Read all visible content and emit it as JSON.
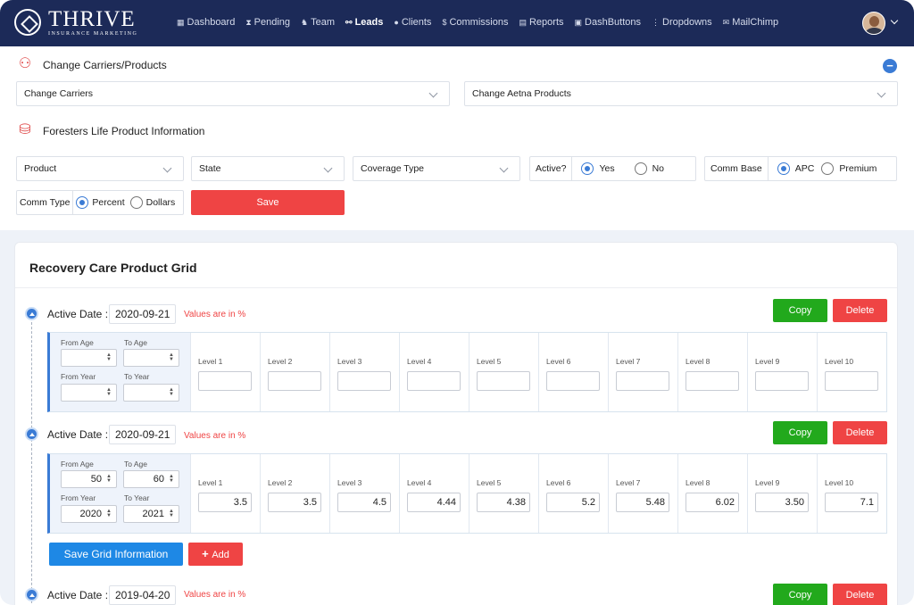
{
  "nav": {
    "brand": "THRIVE",
    "brand_sub": "INSURANCE MARKETING",
    "items": [
      {
        "label": "Dashboard",
        "icon": "grid-icon"
      },
      {
        "label": "Pending",
        "icon": "hourglass-icon"
      },
      {
        "label": "Team",
        "icon": "team-icon"
      },
      {
        "label": "Leads",
        "icon": "link-icon"
      },
      {
        "label": "Clients",
        "icon": "user-icon"
      },
      {
        "label": "Commissions",
        "icon": "dollar-icon"
      },
      {
        "label": "Reports",
        "icon": "report-icon"
      },
      {
        "label": "DashButtons",
        "icon": "car-icon"
      },
      {
        "label": "Dropdowns",
        "icon": "vertical-dots-icon"
      },
      {
        "label": "MailChimp",
        "icon": "mail-icon"
      }
    ],
    "active": "Leads"
  },
  "carriers": {
    "title": "Change Carriers/Products",
    "select_carriers": "Change Carriers",
    "select_products": "Change Aetna Products"
  },
  "product_info": {
    "title": "Foresters Life Product Information",
    "product": "Product",
    "state": "State",
    "coverage_type": "Coverage Type",
    "active_label": "Active?",
    "active_yes": "Yes",
    "active_no": "No",
    "comm_base_label": "Comm Base",
    "comm_base_apc": "APC",
    "comm_base_premium": "Premium",
    "comm_type_label": "Comm Type",
    "comm_type_percent": "Percent",
    "comm_type_dollars": "Dollars",
    "save": "Save"
  },
  "grid": {
    "title": "Recovery Care Product Grid",
    "active_date_label": "Active Date :",
    "values_note": "Values are in %",
    "copy": "Copy",
    "delete": "Delete",
    "from_age": "From Age",
    "to_age": "To Age",
    "from_year": "From Year",
    "to_year": "To Year",
    "levels": [
      "Level 1",
      "Level 2",
      "Level 3",
      "Level 4",
      "Level 5",
      "Level 6",
      "Level 7",
      "Level 8",
      "Level 9",
      "Level 10"
    ],
    "save_grid": "Save Grid Information",
    "add": "Add",
    "entries": [
      {
        "date": "2020-09-21",
        "from_age": "",
        "to_age": "",
        "from_year": "",
        "to_year": "",
        "values": [
          "",
          "",
          "",
          "",
          "",
          "",
          "",
          "",
          "",
          ""
        ]
      },
      {
        "date": "2020-09-21",
        "from_age": "50",
        "to_age": "60",
        "from_year": "2020",
        "to_year": "2021",
        "values": [
          "3.5",
          "3.5",
          "4.5",
          "4.44",
          "4.38",
          "5.2",
          "5.48",
          "6.02",
          "3.50",
          "7.1"
        ]
      },
      {
        "date": "2019-04-20"
      }
    ]
  }
}
